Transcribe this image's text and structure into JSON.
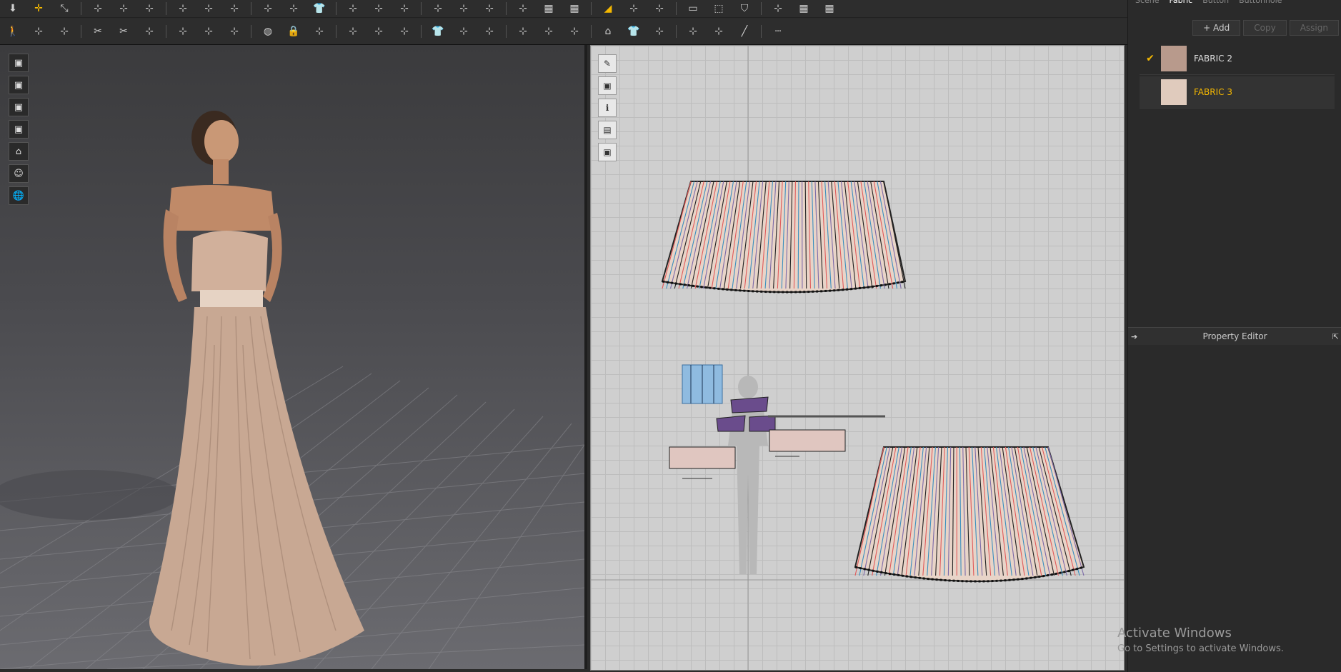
{
  "toolbar": {
    "row1_icons": [
      "import-icon",
      "move-icon",
      "transform-icon",
      "edit-curve-icon",
      "add-point-icon",
      "curve-point-icon",
      "segment-icon",
      "sew-icon",
      "trace-icon",
      "fold-icon",
      "avatar-pose-icon",
      "shirt-icon",
      "garment-icon",
      "fit-icon",
      "tuck-icon",
      "pleat-icon",
      "seam-icon",
      "measure-icon",
      "internal-line-icon",
      "grid-icon",
      "grid-icon-2",
      "highlight-icon",
      "point-select-icon",
      "pin-icon",
      "box-icon",
      "box-select-icon",
      "shield-icon",
      "pleat-fold-icon",
      "grid-icon-3",
      "grid-icon-4"
    ],
    "row2_icons": [
      "walk-icon",
      "select-mesh-icon",
      "edit-mesh-icon",
      "cut-icon",
      "scissor-icon",
      "sew-3d-icon",
      "tack-icon",
      "pin-3d-icon",
      "arrange-icon",
      "sphere-icon",
      "lock-icon",
      "zipper-icon",
      "fold-3d-icon",
      "flatten-icon",
      "split-icon",
      "shirt-3d-icon",
      "garment-3d-icon"
    ],
    "row2b_icons": [
      "edit-pattern-icon",
      "transform-pattern-icon",
      "curve-icon",
      "add-point-2d-icon",
      "iron-icon",
      "shirt-2d-icon",
      "sew-2d-icon",
      "tack-2d-icon",
      "seam-2d-icon",
      "line-icon",
      "dotted-line-icon"
    ]
  },
  "view3d": {
    "side_icons": [
      "shirt-view-icon",
      "texture-view-icon",
      "avatar-view-icon",
      "fabric-view-icon",
      "hanger-icon",
      "face-icon",
      "globe-icon"
    ],
    "fabric_color": "#c8a893"
  },
  "view2d": {
    "tools": [
      "pencil-icon",
      "eye-shirt-icon",
      "info-icon",
      "layers-icon",
      "garment-gray-icon"
    ],
    "accent_red": "#e05a5a",
    "accent_blue": "#3a8fbf"
  },
  "panel": {
    "tabs": [
      "Scene",
      "Fabric",
      "Button",
      "Buttonhole"
    ],
    "active_tab": "Fabric",
    "buttons": {
      "add": "+ Add",
      "copy": "Copy",
      "assign": "Assign"
    },
    "fabrics": [
      {
        "name": "FABRIC 2",
        "color": "#b89a8c",
        "selected": true
      },
      {
        "name": "FABRIC 3",
        "color": "#e0cbbd",
        "selected": false
      }
    ],
    "property_editor": "Property Editor"
  },
  "watermark": {
    "title": "Activate Windows",
    "subtitle": "Go to Settings to activate Windows."
  }
}
